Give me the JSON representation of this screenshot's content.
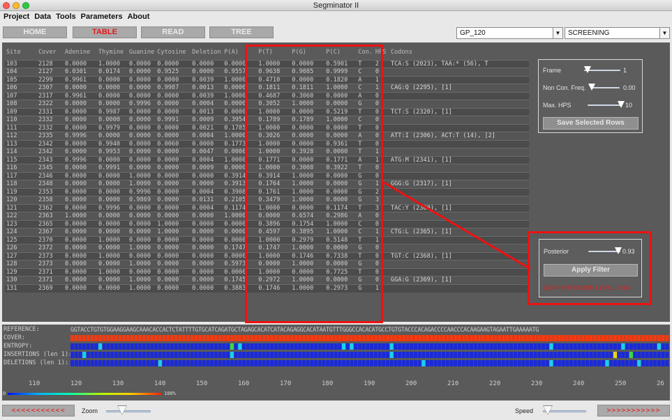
{
  "window": {
    "title": "Segminator II"
  },
  "menu": [
    "Project",
    "Data",
    "Tools",
    "Parameters",
    "About"
  ],
  "nav": {
    "home": "HOME",
    "table": "TABLE",
    "read": "READ",
    "tree": "TREE"
  },
  "selects": {
    "sample": "GP_120",
    "mode": "SCREENING"
  },
  "table": {
    "headers": [
      "Site",
      "Cover",
      "Adenine",
      "Thymine",
      "Guanine",
      "Cytosine",
      "Deletion",
      "P(A)",
      "P(T)",
      "P(G)",
      "P(C)",
      "Con.",
      "HPS",
      "Codons"
    ],
    "rows": [
      [
        "103",
        "2128",
        "0.0000",
        "1.0000",
        "0.0000",
        "0.0000",
        "0.0000",
        "0.0000",
        "1.0000",
        "0.0000",
        "0.5901",
        "T",
        "2",
        "TCA:S (2023), TAA:* (56), T"
      ],
      [
        "104",
        "2127",
        "0.0301",
        "0.0174",
        "0.0000",
        "0.9525",
        "0.0000",
        "0.9557",
        "0.9638",
        "0.9085",
        "0.9999",
        "C",
        "0",
        ""
      ],
      [
        "105",
        "2299",
        "0.9961",
        "0.0000",
        "0.0000",
        "0.0000",
        "0.0039",
        "1.0000",
        "0.4710",
        "0.0000",
        "0.1820",
        "A",
        "1",
        ""
      ],
      [
        "106",
        "2307",
        "0.0000",
        "0.0000",
        "0.0000",
        "0.9987",
        "0.0013",
        "0.0000",
        "0.1811",
        "0.1811",
        "1.0000",
        "C",
        "1",
        "CAG:Q (2295),  [1]"
      ],
      [
        "107",
        "2317",
        "0.9961",
        "0.0000",
        "0.0000",
        "0.0000",
        "0.0039",
        "1.0000",
        "0.4687",
        "0.3060",
        "0.0000",
        "A",
        "0",
        ""
      ],
      [
        "108",
        "2322",
        "0.0000",
        "0.0000",
        "0.9996",
        "0.0000",
        "0.0004",
        "0.0000",
        "0.3052",
        "1.0000",
        "0.0000",
        "G",
        "0",
        ""
      ],
      [
        "109",
        "2331",
        "0.0000",
        "0.9987",
        "0.0000",
        "0.0000",
        "0.0013",
        "0.0000",
        "1.0000",
        "0.0000",
        "0.5219",
        "T",
        "0",
        "TCT:S (2320),  [1]"
      ],
      [
        "110",
        "2332",
        "0.0000",
        "0.0000",
        "0.0000",
        "0.9991",
        "0.0009",
        "0.3954",
        "0.1789",
        "0.1789",
        "1.0000",
        "C",
        "0",
        ""
      ],
      [
        "111",
        "2332",
        "0.0000",
        "0.9979",
        "0.0000",
        "0.0000",
        "0.0021",
        "0.1785",
        "1.0000",
        "0.0000",
        "0.0000",
        "T",
        "0",
        ""
      ],
      [
        "112",
        "2335",
        "0.9996",
        "0.0000",
        "0.0000",
        "0.0000",
        "0.0004",
        "1.0000",
        "0.3026",
        "0.0000",
        "0.0000",
        "A",
        "0",
        "ATT:I (2306), ACT:T (14),  [2]"
      ],
      [
        "113",
        "2342",
        "0.0000",
        "0.9940",
        "0.0000",
        "0.0060",
        "0.0000",
        "0.1773",
        "1.0000",
        "0.0000",
        "0.9361",
        "T",
        "0",
        ""
      ],
      [
        "114",
        "2342",
        "0.0000",
        "0.9953",
        "0.0000",
        "0.0000",
        "0.0047",
        "0.0000",
        "1.0000",
        "0.3928",
        "0.0000",
        "T",
        "1",
        ""
      ],
      [
        "115",
        "2343",
        "0.9996",
        "0.0000",
        "0.0000",
        "0.0000",
        "0.0004",
        "1.0000",
        "0.1771",
        "0.0000",
        "0.1771",
        "A",
        "1",
        "ATG:M (2341),  [1]"
      ],
      [
        "116",
        "2345",
        "0.0000",
        "0.9991",
        "0.0000",
        "0.0000",
        "0.0009",
        "0.0000",
        "1.0000",
        "0.3008",
        "0.3922",
        "T",
        "0",
        ""
      ],
      [
        "117",
        "2346",
        "0.0000",
        "0.0000",
        "1.0000",
        "0.0000",
        "0.0000",
        "0.3914",
        "0.3914",
        "1.0000",
        "0.0000",
        "G",
        "0",
        ""
      ],
      [
        "118",
        "2348",
        "0.0000",
        "0.0000",
        "1.0000",
        "0.0000",
        "0.0000",
        "0.3913",
        "0.1764",
        "1.0000",
        "0.0000",
        "G",
        "1",
        "GGG:G (2317),  [1]"
      ],
      [
        "119",
        "2353",
        "0.0000",
        "0.0000",
        "0.9996",
        "0.0000",
        "0.0004",
        "0.3908",
        "0.1761",
        "1.0000",
        "0.0000",
        "G",
        "2",
        ""
      ],
      [
        "120",
        "2358",
        "0.0000",
        "0.0000",
        "0.9869",
        "0.0000",
        "0.0131",
        "0.2105",
        "0.3479",
        "1.0000",
        "0.0000",
        "G",
        "3",
        ""
      ],
      [
        "121",
        "2362",
        "0.0000",
        "0.9996",
        "0.0000",
        "0.0000",
        "0.0004",
        "0.1174",
        "1.0000",
        "0.0000",
        "0.1174",
        "T",
        "3",
        "TAC:Y (2360),  [1]"
      ],
      [
        "122",
        "2363",
        "1.0000",
        "0.0000",
        "0.0000",
        "0.0000",
        "0.0000",
        "1.0000",
        "0.0000",
        "0.6574",
        "0.2986",
        "A",
        "0",
        ""
      ],
      [
        "123",
        "2365",
        "0.0000",
        "0.0000",
        "0.0000",
        "1.0000",
        "0.0000",
        "0.0000",
        "0.3896",
        "0.1754",
        "1.0000",
        "C",
        "0",
        ""
      ],
      [
        "124",
        "2367",
        "0.0000",
        "0.0000",
        "0.0000",
        "1.0000",
        "0.0000",
        "0.0000",
        "0.4597",
        "0.3895",
        "1.0000",
        "C",
        "1",
        "CTG:L (2365),  [1]"
      ],
      [
        "125",
        "2370",
        "0.0000",
        "1.0000",
        "0.0000",
        "0.0000",
        "0.0000",
        "0.0000",
        "1.0000",
        "0.2979",
        "0.5148",
        "T",
        "1",
        ""
      ],
      [
        "126",
        "2372",
        "0.0000",
        "0.0000",
        "1.0000",
        "0.0000",
        "0.0000",
        "0.1747",
        "0.1747",
        "1.0000",
        "0.0000",
        "G",
        "0",
        ""
      ],
      [
        "127",
        "2373",
        "0.0000",
        "1.0000",
        "0.0000",
        "0.0000",
        "0.0000",
        "0.0000",
        "1.0000",
        "0.1746",
        "0.7338",
        "T",
        "0",
        "TGT:C (2368),  [1]"
      ],
      [
        "128",
        "2373",
        "0.0000",
        "0.0000",
        "1.0000",
        "0.0000",
        "0.0000",
        "0.5973",
        "0.0000",
        "1.0000",
        "0.0000",
        "G",
        "0",
        ""
      ],
      [
        "129",
        "2371",
        "0.0000",
        "1.0000",
        "0.0000",
        "0.0000",
        "0.0000",
        "0.0000",
        "1.0000",
        "0.0000",
        "0.7725",
        "T",
        "0",
        ""
      ],
      [
        "130",
        "2371",
        "0.0000",
        "0.0000",
        "1.0000",
        "0.0000",
        "0.0000",
        "0.1745",
        "0.2972",
        "1.0000",
        "0.0000",
        "G",
        "0",
        "GGA:G (2369),  [1]"
      ],
      [
        "131",
        "2369",
        "0.0000",
        "0.0000",
        "1.0000",
        "0.0000",
        "0.0000",
        "0.3883",
        "0.1746",
        "1.0000",
        "0.2973",
        "G",
        "1",
        ""
      ]
    ]
  },
  "screening_panel": {
    "frame_label": "Frame",
    "frame_value": "1",
    "frame_level": 0.1,
    "ncf_label": "Non Con. Freq.",
    "ncf_value": "0.00",
    "ncf_level": 0.0,
    "hps_label": "Max. HPS",
    "hps_value": "10",
    "hps_level": 0.95,
    "save_label": "Save Selected Rows"
  },
  "filter_panel": {
    "posterior_label": "Posterior",
    "posterior_value": "0.93",
    "posterior_level": 0.93,
    "apply_label": "Apply Filter",
    "status": "CURRENT FILTER LEVEL: 0.93"
  },
  "tracks": {
    "reference_label": "REFERENCE:",
    "reference_seq": "GGTACCTGTGTGGAAGGAAGCAAACACCACTCTATTTTGTGCATCAGATGCTAGAGCACATCATACAGAGGCACATAATGTTTGGGCCACACATGCCTGTGTACCCACAGACCCCAACCCACAAGAAGTAGAATTGAAAAATG",
    "cover_label": "COVER:",
    "entropy_label": "ENTROPY:",
    "insertions_label": "INSERTIONS (len 1):",
    "deletions_label": "DELETIONS (len 1):",
    "ruler": [
      "110",
      "120",
      "130",
      "140",
      "150",
      "160",
      "170",
      "180",
      "190",
      "200",
      "210",
      "220",
      "230",
      "240",
      "250",
      "26"
    ],
    "legend_min": "0",
    "legend_max": "100%"
  },
  "colors": {
    "accent_red": "#e11111",
    "cover_red": "#f23a10",
    "track_blue": "#1a2ad8",
    "cyan": "#18d0f0",
    "green": "#3bd84a",
    "yellow": "#e6d616"
  },
  "footer": {
    "prev_label": "<<<<<<<<<<<",
    "zoom_label": "Zoom",
    "speed_label": "Speed",
    "next_label": ">>>>>>>>>>>"
  }
}
